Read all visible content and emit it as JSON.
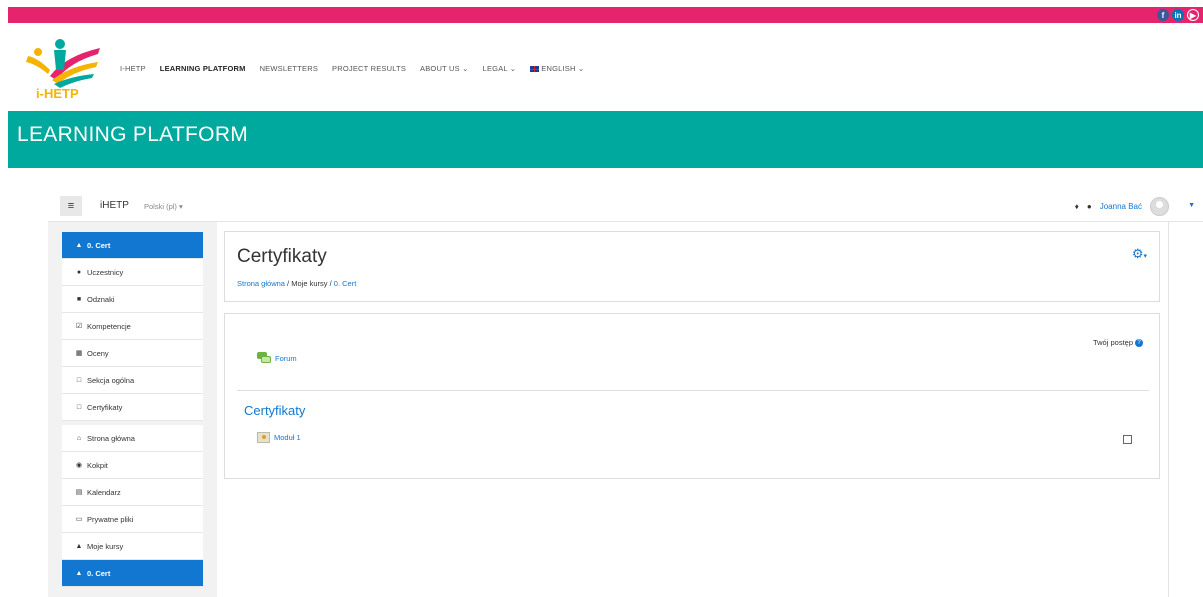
{
  "social": [
    "f",
    "in",
    "▶"
  ],
  "nav": {
    "items": [
      {
        "label": "I-HETP"
      },
      {
        "label": "LEARNING PLATFORM"
      },
      {
        "label": "NEWSLETTERS"
      },
      {
        "label": "PROJECT RESULTS"
      },
      {
        "label": "ABOUT US ⌄"
      },
      {
        "label": "LEGAL ⌄"
      },
      {
        "label": "ENGLISH ⌄"
      }
    ]
  },
  "logo_text": "i-HETP",
  "banner": {
    "title": "LEARNING PLATFORM"
  },
  "moodle": {
    "brand": "iHETP",
    "language": "Polski (pl) ▾",
    "user_name": "Joanna Bać"
  },
  "sidebar": {
    "items": [
      {
        "label": "0. Cert",
        "icon": "graduation-cap-icon"
      },
      {
        "label": "Uczestnicy",
        "icon": "users-icon"
      },
      {
        "label": "Odznaki",
        "icon": "shield-icon"
      },
      {
        "label": "Kompetencje",
        "icon": "check-square-icon"
      },
      {
        "label": "Oceny",
        "icon": "table-icon"
      },
      {
        "label": "Sekcja ogólna",
        "icon": "folder-icon"
      },
      {
        "label": "Certyfikaty",
        "icon": "folder-icon"
      },
      {
        "label": "Strona główna",
        "icon": "home-icon"
      },
      {
        "label": "Kokpit",
        "icon": "dashboard-icon"
      },
      {
        "label": "Kalendarz",
        "icon": "calendar-icon"
      },
      {
        "label": "Prywatne pliki",
        "icon": "file-icon"
      },
      {
        "label": "Moje kursy",
        "icon": "graduation-cap-icon"
      },
      {
        "label": "0. Cert",
        "icon": "graduation-cap-icon"
      }
    ]
  },
  "page": {
    "title": "Certyfikaty",
    "breadcrumb": [
      "Strona główna",
      "Moje kursy",
      "0. Cert"
    ],
    "breadcrumb_sep": "/"
  },
  "course": {
    "progress_label": "Twój postęp",
    "forum_label": "Forum",
    "section_title": "Certyfikaty",
    "module_label": "Moduł 1"
  },
  "colors": {
    "topbar": "#e6246e",
    "banner": "#00a99d",
    "accent": "#1177d1"
  }
}
